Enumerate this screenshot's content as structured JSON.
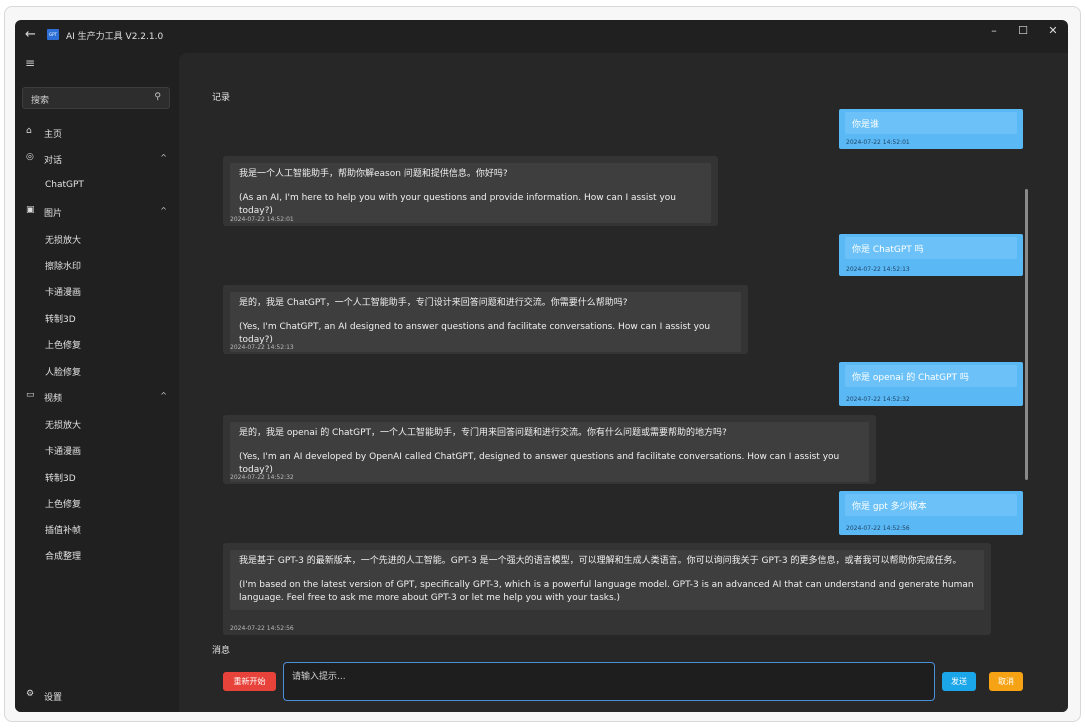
{
  "window": {
    "title": "AI 生产力工具 V2.2.1.0",
    "minimize": "–",
    "maximize": "☐",
    "close": "✕"
  },
  "sidebar": {
    "search_placeholder": "搜索",
    "home": "主页",
    "chat_group": "对话",
    "chat_items": [
      "ChatGPT"
    ],
    "image_group": "图片",
    "image_items": [
      "无损放大",
      "擦除水印",
      "卡通漫画",
      "转制3D",
      "上色修复",
      "人脸修复"
    ],
    "video_group": "视频",
    "video_items": [
      "无损放大",
      "卡通漫画",
      "转制3D",
      "上色修复",
      "插值补帧",
      "合成整理"
    ],
    "settings": "设置"
  },
  "main": {
    "records_label": "记录",
    "message_label": "消息",
    "input_placeholder": "请输入提示...",
    "restart_button": "重新开始",
    "send_button": "发送",
    "cancel_button": "取消"
  },
  "messages": [
    {
      "role": "user",
      "text": "你是谁",
      "time": "2024-07-22 14:52:01"
    },
    {
      "role": "ai",
      "text_cn": "我是一个人工智能助手，帮助你解eason 问题和提供信息。你好吗?",
      "text_en": "(As an AI, I'm here to help you with your questions and provide information. How can I assist you today?)",
      "time": "2024-07-22 14:52:01"
    },
    {
      "role": "user",
      "text": "你是 ChatGPT 吗",
      "time": "2024-07-22 14:52:13"
    },
    {
      "role": "ai",
      "text_cn": "是的，我是 ChatGPT，一个人工智能助手，专门设计来回答问题和进行交流。你需要什么帮助吗?",
      "text_en": "(Yes, I'm ChatGPT, an AI designed to answer questions and facilitate conversations. How can I assist you today?)",
      "time": "2024-07-22 14:52:13"
    },
    {
      "role": "user",
      "text": "你是 openai 的 ChatGPT 吗",
      "time": "2024-07-22 14:52:32"
    },
    {
      "role": "ai",
      "text_cn": "是的，我是 openai 的 ChatGPT，一个人工智能助手，专门用来回答问题和进行交流。你有什么问题或需要帮助的地方吗?",
      "text_en": "(Yes, I'm an AI developed by OpenAI called ChatGPT, designed to answer questions and facilitate conversations. How can I assist you today?)",
      "time": "2024-07-22 14:52:32"
    },
    {
      "role": "user",
      "text": "你是 gpt 多少版本",
      "time": "2024-07-22 14:52:56"
    },
    {
      "role": "ai",
      "text_cn": "我是基于 GPT-3 的最新版本，一个先进的人工智能。GPT-3 是一个强大的语言模型，可以理解和生成人类语言。你可以询问我关于 GPT-3 的更多信息，或者我可以帮助你完成任务。",
      "text_en": "(I'm based on the latest version of GPT, specifically GPT-3, which is a powerful language model. GPT-3 is an advanced AI that can understand and generate human language. Feel free to ask me more about GPT-3 or let me help you with your tasks.)",
      "time": "2024-07-22 14:52:56"
    }
  ]
}
